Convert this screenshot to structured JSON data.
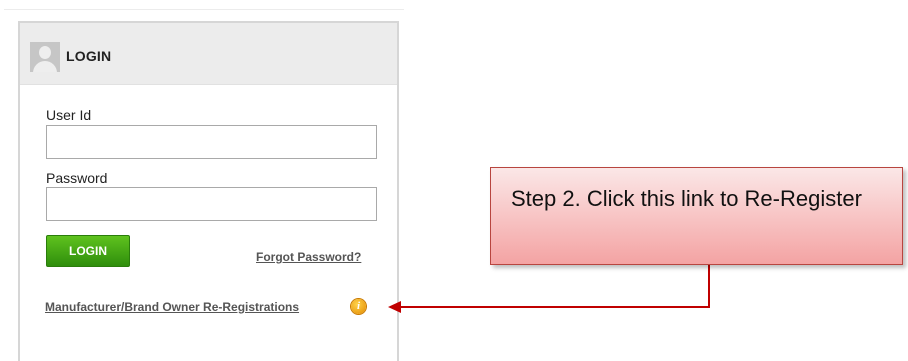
{
  "login_panel": {
    "title": "LOGIN",
    "user_id_label": "User Id",
    "user_id_value": "",
    "password_label": "Password",
    "password_value": "",
    "login_button": "LOGIN",
    "forgot_password_link": "Forgot Password?",
    "reregistration_link": "Manufacturer/Brand Owner Re-Registrations",
    "info_icon_glyph": "i"
  },
  "annotation": {
    "callout_text": "Step 2. Click this link to Re-Register",
    "callout_border_color": "#b8453f",
    "arrow_color": "#c00000"
  },
  "icons": [
    "user-avatar-icon",
    "info-icon",
    "arrow-icon"
  ],
  "colors": {
    "login_button": "#3fa513",
    "header_background": "#ececec"
  }
}
